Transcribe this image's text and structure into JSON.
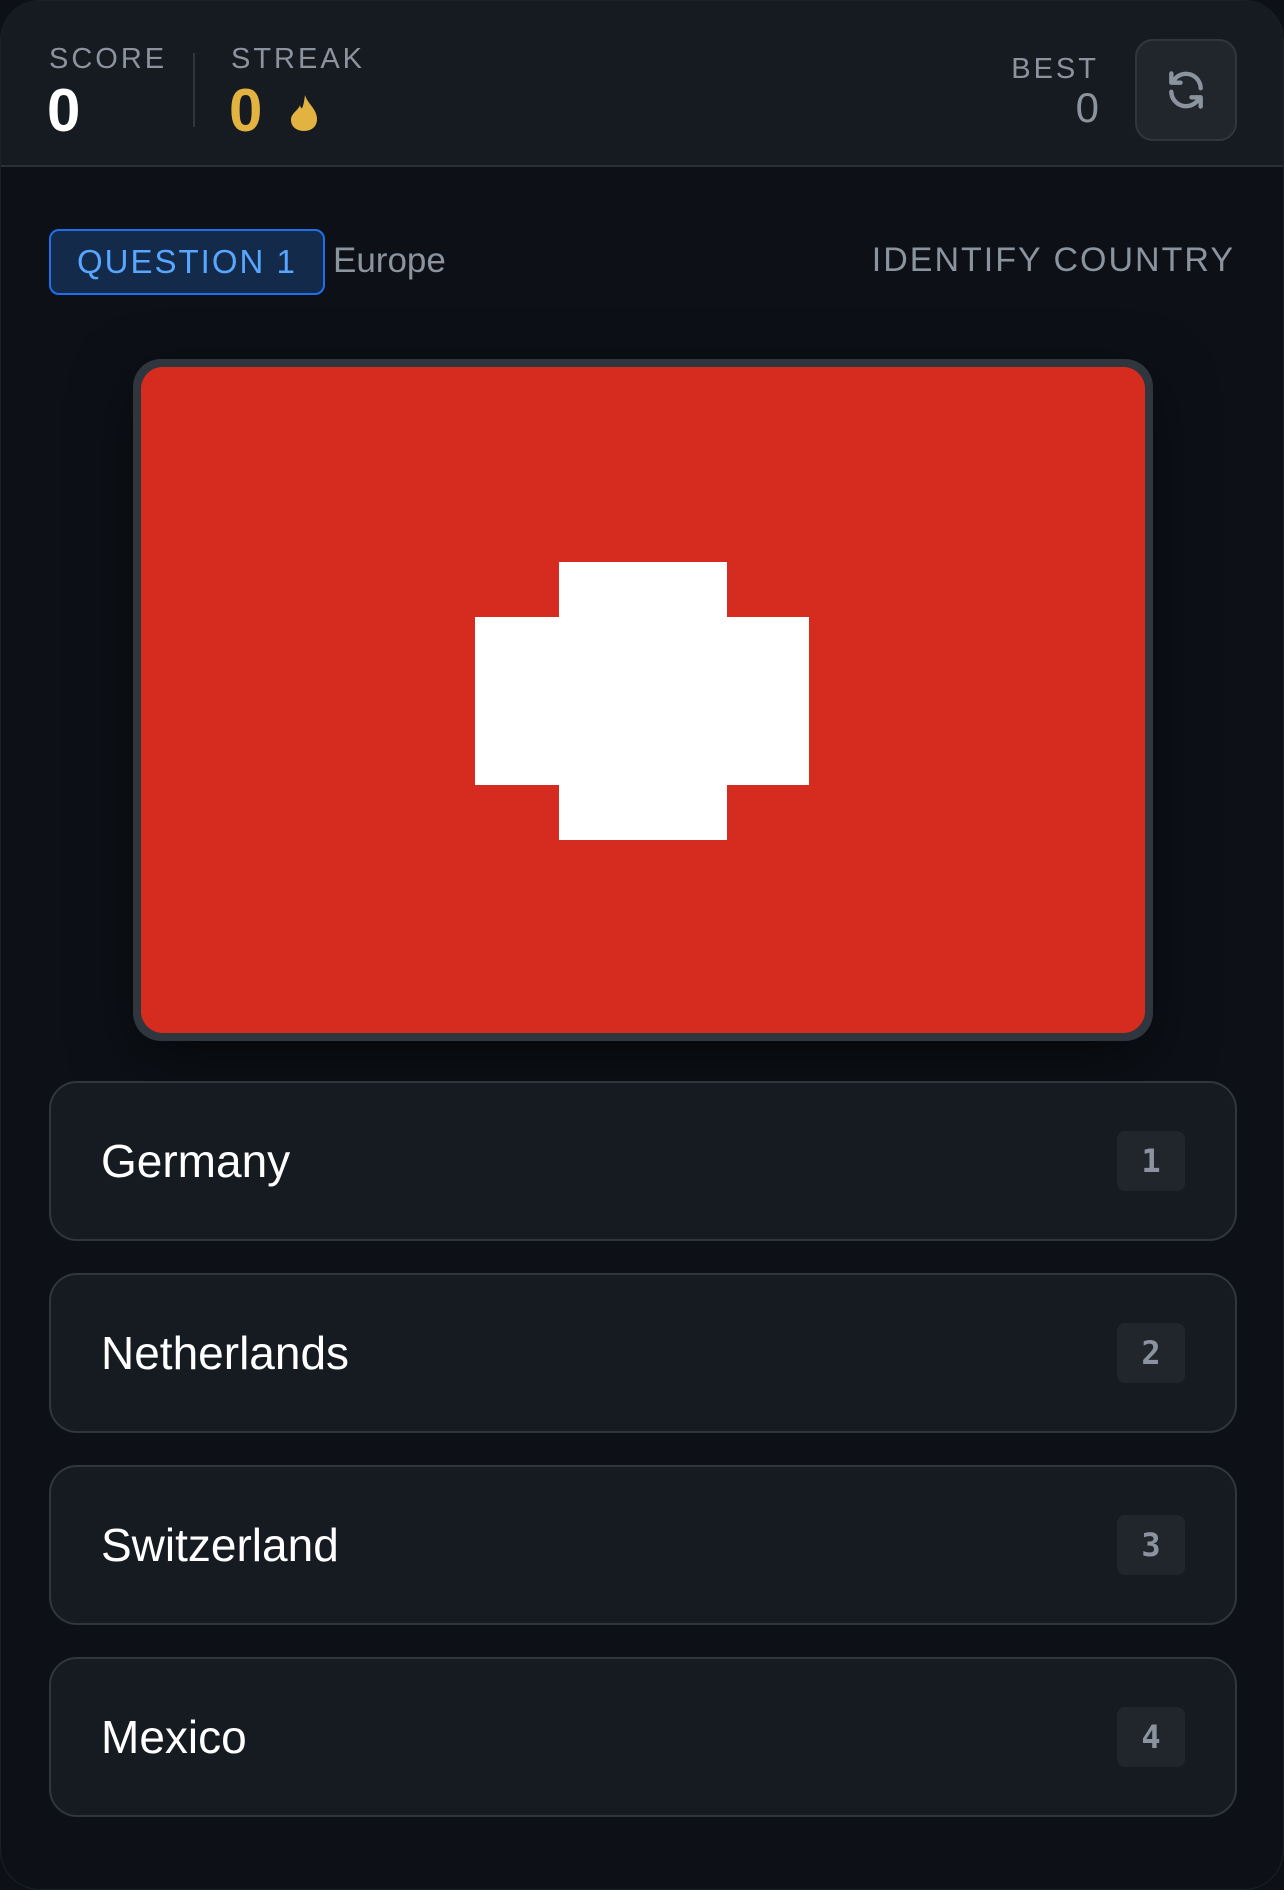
{
  "header": {
    "score_label": "SCORE",
    "score_value": "0",
    "streak_label": "STREAK",
    "streak_value": "0",
    "best_label": "BEST",
    "best_value": "0",
    "refresh_icon": "refresh-icon",
    "streak_icon": "fire-icon"
  },
  "question": {
    "badge": "QUESTION 1",
    "region": "Europe",
    "mode": "IDENTIFY COUNTRY"
  },
  "flag": {
    "icon": "flag-image",
    "background_color": "#d62b1f",
    "cross_color": "#ffffff"
  },
  "options": [
    {
      "label": "Germany",
      "key": "1"
    },
    {
      "label": "Netherlands",
      "key": "2"
    },
    {
      "label": "Switzerland",
      "key": "3"
    },
    {
      "label": "Mexico",
      "key": "4"
    }
  ],
  "colors": {
    "background": "#0d1117",
    "panel": "#161b22",
    "accent_blue": "#58a6ff",
    "accent_gold": "#e3b341"
  }
}
